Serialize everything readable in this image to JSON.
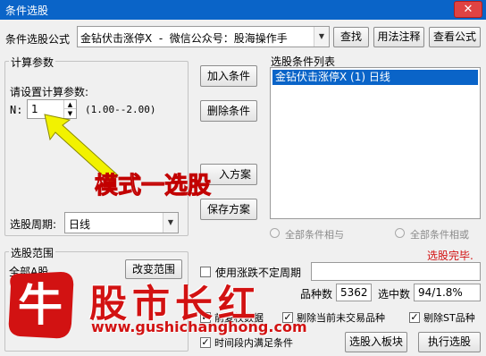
{
  "window": {
    "title": "条件选股",
    "close_glyph": "✕"
  },
  "formula": {
    "label": "条件选股公式",
    "value": "金钻伏击涨停X  -  微信公众号：股海操作手",
    "find": "查找",
    "usage": "用法注释",
    "view": "查看公式"
  },
  "params": {
    "group_title": "计算参数",
    "prompt": "请设置计算参数:",
    "n_label": "N:",
    "n_value": "1",
    "range": "(1.00--2.00)",
    "period_label": "选股周期:",
    "period_value": "日线"
  },
  "buttons": {
    "add": "加入条件",
    "delete": "删除条件",
    "plan_partial": "入方案",
    "save_plan": "保存方案",
    "change_range": "改变范围",
    "to_block": "选股入板块",
    "run": "执行选股"
  },
  "conditions": {
    "group_title": "选股条件列表",
    "items": [
      "金钻伏击涨停X (1) 日线"
    ],
    "radio_and": "全部条件相与",
    "radio_or": "全部条件相或"
  },
  "status": {
    "done": "选股完毕."
  },
  "options": {
    "use_period": "使用涨跌不定周期",
    "count_label": "品种数",
    "count_value": "5362",
    "selected_label": "选中数",
    "selected_value": "94/1.8%",
    "fq": "前复权数据",
    "no_trade": "剔除当前未交易品种",
    "no_st": "剔除ST品种",
    "time_span": "时间段内满足条件",
    "check_glyph": "✓"
  },
  "scope": {
    "group_title": "选股范围",
    "partial_value": "全部A股"
  },
  "annotation": {
    "text": "模式一选股"
  },
  "brand": {
    "logo_char": "牛",
    "name": "股市长红",
    "url": "www.gushichanghong.com"
  },
  "colors": {
    "title_bar": "#0a64c8",
    "selection": "#0a64c8",
    "status_red": "#d21212",
    "annotation_arrow": "#f2f200"
  }
}
